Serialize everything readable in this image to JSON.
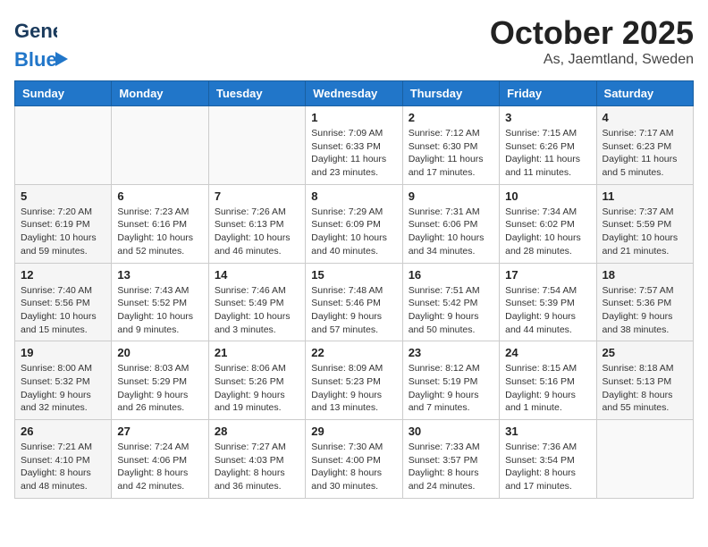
{
  "header": {
    "logo_general": "General",
    "logo_blue": "Blue",
    "title": "October 2025",
    "subtitle": "As, Jaemtland, Sweden"
  },
  "weekdays": [
    "Sunday",
    "Monday",
    "Tuesday",
    "Wednesday",
    "Thursday",
    "Friday",
    "Saturday"
  ],
  "weeks": [
    [
      {
        "day": "",
        "info": ""
      },
      {
        "day": "",
        "info": ""
      },
      {
        "day": "",
        "info": ""
      },
      {
        "day": "1",
        "info": "Sunrise: 7:09 AM\nSunset: 6:33 PM\nDaylight: 11 hours\nand 23 minutes."
      },
      {
        "day": "2",
        "info": "Sunrise: 7:12 AM\nSunset: 6:30 PM\nDaylight: 11 hours\nand 17 minutes."
      },
      {
        "day": "3",
        "info": "Sunrise: 7:15 AM\nSunset: 6:26 PM\nDaylight: 11 hours\nand 11 minutes."
      },
      {
        "day": "4",
        "info": "Sunrise: 7:17 AM\nSunset: 6:23 PM\nDaylight: 11 hours\nand 5 minutes."
      }
    ],
    [
      {
        "day": "5",
        "info": "Sunrise: 7:20 AM\nSunset: 6:19 PM\nDaylight: 10 hours\nand 59 minutes."
      },
      {
        "day": "6",
        "info": "Sunrise: 7:23 AM\nSunset: 6:16 PM\nDaylight: 10 hours\nand 52 minutes."
      },
      {
        "day": "7",
        "info": "Sunrise: 7:26 AM\nSunset: 6:13 PM\nDaylight: 10 hours\nand 46 minutes."
      },
      {
        "day": "8",
        "info": "Sunrise: 7:29 AM\nSunset: 6:09 PM\nDaylight: 10 hours\nand 40 minutes."
      },
      {
        "day": "9",
        "info": "Sunrise: 7:31 AM\nSunset: 6:06 PM\nDaylight: 10 hours\nand 34 minutes."
      },
      {
        "day": "10",
        "info": "Sunrise: 7:34 AM\nSunset: 6:02 PM\nDaylight: 10 hours\nand 28 minutes."
      },
      {
        "day": "11",
        "info": "Sunrise: 7:37 AM\nSunset: 5:59 PM\nDaylight: 10 hours\nand 21 minutes."
      }
    ],
    [
      {
        "day": "12",
        "info": "Sunrise: 7:40 AM\nSunset: 5:56 PM\nDaylight: 10 hours\nand 15 minutes."
      },
      {
        "day": "13",
        "info": "Sunrise: 7:43 AM\nSunset: 5:52 PM\nDaylight: 10 hours\nand 9 minutes."
      },
      {
        "day": "14",
        "info": "Sunrise: 7:46 AM\nSunset: 5:49 PM\nDaylight: 10 hours\nand 3 minutes."
      },
      {
        "day": "15",
        "info": "Sunrise: 7:48 AM\nSunset: 5:46 PM\nDaylight: 9 hours\nand 57 minutes."
      },
      {
        "day": "16",
        "info": "Sunrise: 7:51 AM\nSunset: 5:42 PM\nDaylight: 9 hours\nand 50 minutes."
      },
      {
        "day": "17",
        "info": "Sunrise: 7:54 AM\nSunset: 5:39 PM\nDaylight: 9 hours\nand 44 minutes."
      },
      {
        "day": "18",
        "info": "Sunrise: 7:57 AM\nSunset: 5:36 PM\nDaylight: 9 hours\nand 38 minutes."
      }
    ],
    [
      {
        "day": "19",
        "info": "Sunrise: 8:00 AM\nSunset: 5:32 PM\nDaylight: 9 hours\nand 32 minutes."
      },
      {
        "day": "20",
        "info": "Sunrise: 8:03 AM\nSunset: 5:29 PM\nDaylight: 9 hours\nand 26 minutes."
      },
      {
        "day": "21",
        "info": "Sunrise: 8:06 AM\nSunset: 5:26 PM\nDaylight: 9 hours\nand 19 minutes."
      },
      {
        "day": "22",
        "info": "Sunrise: 8:09 AM\nSunset: 5:23 PM\nDaylight: 9 hours\nand 13 minutes."
      },
      {
        "day": "23",
        "info": "Sunrise: 8:12 AM\nSunset: 5:19 PM\nDaylight: 9 hours\nand 7 minutes."
      },
      {
        "day": "24",
        "info": "Sunrise: 8:15 AM\nSunset: 5:16 PM\nDaylight: 9 hours\nand 1 minute."
      },
      {
        "day": "25",
        "info": "Sunrise: 8:18 AM\nSunset: 5:13 PM\nDaylight: 8 hours\nand 55 minutes."
      }
    ],
    [
      {
        "day": "26",
        "info": "Sunrise: 7:21 AM\nSunset: 4:10 PM\nDaylight: 8 hours\nand 48 minutes."
      },
      {
        "day": "27",
        "info": "Sunrise: 7:24 AM\nSunset: 4:06 PM\nDaylight: 8 hours\nand 42 minutes."
      },
      {
        "day": "28",
        "info": "Sunrise: 7:27 AM\nSunset: 4:03 PM\nDaylight: 8 hours\nand 36 minutes."
      },
      {
        "day": "29",
        "info": "Sunrise: 7:30 AM\nSunset: 4:00 PM\nDaylight: 8 hours\nand 30 minutes."
      },
      {
        "day": "30",
        "info": "Sunrise: 7:33 AM\nSunset: 3:57 PM\nDaylight: 8 hours\nand 24 minutes."
      },
      {
        "day": "31",
        "info": "Sunrise: 7:36 AM\nSunset: 3:54 PM\nDaylight: 8 hours\nand 17 minutes."
      },
      {
        "day": "",
        "info": ""
      }
    ]
  ]
}
